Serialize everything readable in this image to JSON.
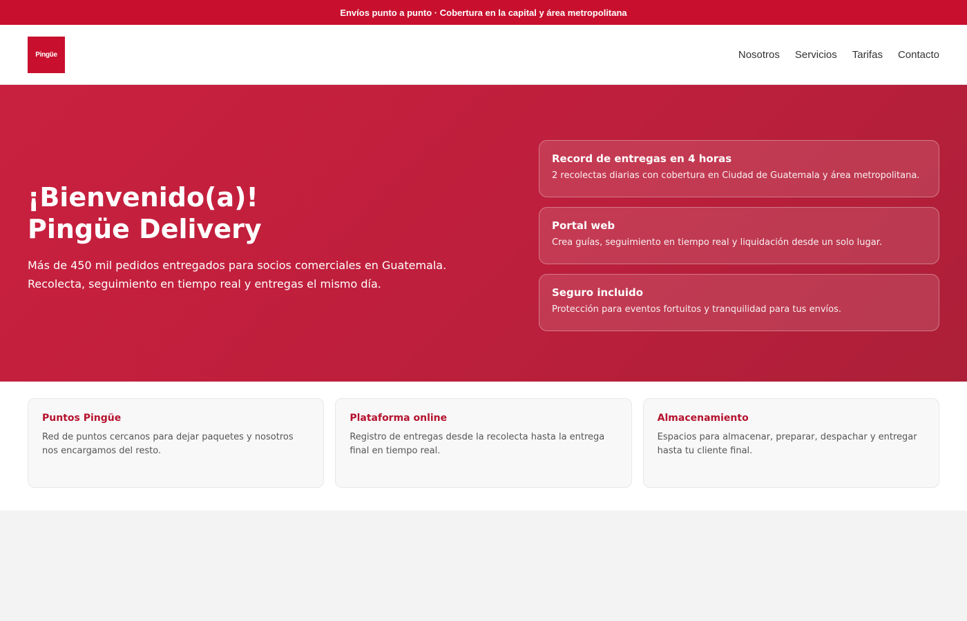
{
  "topbar": {
    "text": "Envíos punto a punto · Cobertura en la capital y área metropolitana"
  },
  "header": {
    "logo_text": "Pingüe",
    "nav": [
      {
        "label": "Nosotros"
      },
      {
        "label": "Servicios"
      },
      {
        "label": "Tarifas"
      },
      {
        "label": "Contacto"
      }
    ]
  },
  "hero": {
    "title_line1": "¡Bienvenido(a)!",
    "title_line2": "Pingüe Delivery",
    "subtitle_line1": "Más de 450 mil pedidos entregados para socios comerciales en Guatemala.",
    "subtitle_line2": "Recolecta, seguimiento en tiempo real y entregas el mismo día.",
    "features": [
      {
        "title": "Record de entregas en 4 horas",
        "desc": "2 recolectas diarias con cobertura en Ciudad de Guatemala y área metropolitana."
      },
      {
        "title": "Portal web",
        "desc": "Crea guías, seguimiento en tiempo real y liquidación desde un solo lugar."
      },
      {
        "title": "Seguro incluido",
        "desc": "Protección para eventos fortuitos y tranquilidad para tus envíos."
      }
    ]
  },
  "services": [
    {
      "title": "Puntos Pingüe",
      "desc": "Red de puntos cercanos para dejar paquetes y nosotros nos encargamos del resto."
    },
    {
      "title": "Plataforma online",
      "desc": "Registro de entregas desde la recolecta hasta la entrega final en tiempo real."
    },
    {
      "title": "Almacenamiento",
      "desc": "Espacios para almacenar, preparar, despachar y entregar hasta tu cliente final."
    }
  ],
  "colors": {
    "brand_red": "#c8102e",
    "service_title": "#b5122e",
    "page_bg": "#f3f3f3"
  }
}
